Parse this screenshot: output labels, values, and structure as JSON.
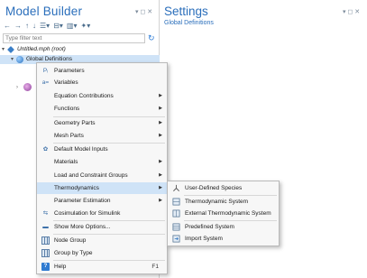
{
  "model_builder": {
    "title": "Model Builder",
    "filter_placeholder": "Type filter text",
    "tree": {
      "root_label": "Untitled.mph (root)",
      "global_label": "Global Definitions"
    }
  },
  "settings": {
    "title": "Settings",
    "subtitle": "Global Definitions"
  },
  "context_menu": {
    "items": [
      {
        "label": "Parameters",
        "icon": "parameters-icon",
        "arrow": false
      },
      {
        "label": "Variables",
        "icon": "variables-icon",
        "arrow": false
      },
      {
        "label": "Equation Contributions",
        "icon": "",
        "arrow": true
      },
      {
        "label": "Functions",
        "icon": "",
        "arrow": true
      },
      {
        "label": "Geometry Parts",
        "icon": "",
        "arrow": true
      },
      {
        "label": "Mesh Parts",
        "icon": "",
        "arrow": true
      },
      {
        "label": "Default Model Inputs",
        "icon": "model-inputs-icon",
        "arrow": false
      },
      {
        "label": "Materials",
        "icon": "",
        "arrow": true
      },
      {
        "label": "Load and Constraint Groups",
        "icon": "",
        "arrow": true
      },
      {
        "label": "Thermodynamics",
        "icon": "",
        "arrow": true,
        "highlighted": true
      },
      {
        "label": "Parameter Estimation",
        "icon": "",
        "arrow": true
      },
      {
        "label": "Cosimulation for Simulink",
        "icon": "simulink-icon",
        "arrow": false
      },
      {
        "label": "Show More Options...",
        "icon": "options-icon",
        "arrow": false
      },
      {
        "label": "Node Group",
        "icon": "node-group-icon",
        "arrow": false
      },
      {
        "label": "Group by Type",
        "icon": "group-by-type-icon",
        "arrow": false
      },
      {
        "label": "Help",
        "icon": "help-icon",
        "arrow": false,
        "shortcut": "F1"
      }
    ]
  },
  "thermodynamics_submenu": {
    "items": [
      {
        "label": "User-Defined Species",
        "icon": "species-icon"
      },
      {
        "label": "Thermodynamic System",
        "icon": "system-icon"
      },
      {
        "label": "External Thermodynamic System",
        "icon": "external-system-icon"
      },
      {
        "label": "Predefined System",
        "icon": "predefined-system-icon"
      },
      {
        "label": "Import System",
        "icon": "import-system-icon"
      }
    ]
  },
  "colors": {
    "accent": "#2a6ebb",
    "highlight": "#cfe3f7",
    "menu_bg": "#f7f7f7"
  }
}
